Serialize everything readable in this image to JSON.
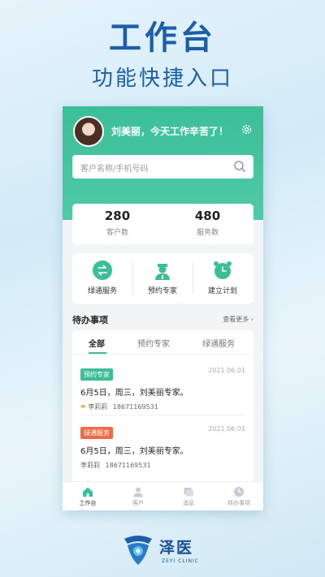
{
  "promo": {
    "title": "工作台",
    "subtitle": "功能快捷入口"
  },
  "header": {
    "greeting": "刘美丽，今天工作辛苦了！"
  },
  "search": {
    "placeholder": "客户名称/手机号码"
  },
  "stats": [
    {
      "value": "280",
      "label": "客户数"
    },
    {
      "value": "480",
      "label": "服务数"
    }
  ],
  "quick": [
    {
      "label": "绿通服务",
      "icon": "exchange-icon"
    },
    {
      "label": "预约专家",
      "icon": "doctor-icon"
    },
    {
      "label": "建立计划",
      "icon": "alarm-clock-icon"
    }
  ],
  "todo": {
    "title": "待办事项",
    "more": "查看更多 ›",
    "tabs": [
      "全部",
      "预约专家",
      "绿通服务"
    ],
    "active_tab": 0,
    "items": [
      {
        "badge": "预约专家",
        "badge_color": "#3cbf98",
        "date": "2021.06.01",
        "text": "6月5日，周三，刘美丽专家。",
        "contact": "李莉莉",
        "phone": "18671169531"
      },
      {
        "badge": "绿通服务",
        "badge_color": "#ef6b45",
        "date": "2021.06.01",
        "text": "6月5日，周三，刘美丽专家。",
        "contact": "李莉莉",
        "phone": "18671169531"
      }
    ]
  },
  "tabbar": [
    {
      "label": "工作台",
      "icon": "home-icon",
      "active": true
    },
    {
      "label": "客户",
      "icon": "person-icon",
      "active": false
    },
    {
      "label": "消息",
      "icon": "message-icon",
      "active": false
    },
    {
      "label": "待办事项",
      "icon": "clock-icon",
      "active": false
    }
  ],
  "brand": {
    "name": "泽医",
    "sub": "ZEYI CLINIC"
  },
  "colors": {
    "accent": "#3cbf98",
    "brand_blue": "#1c5fa8",
    "orange": "#ef6b45"
  }
}
